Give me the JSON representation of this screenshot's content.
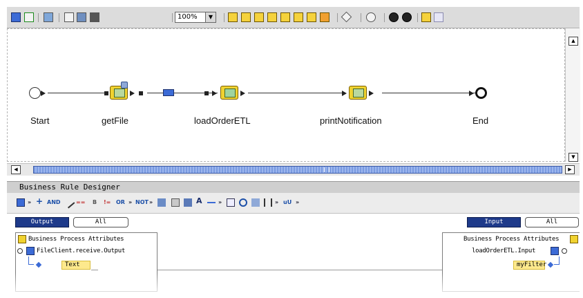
{
  "toolbar": {
    "zoom_value": "100%"
  },
  "canvas": {
    "nodes": [
      {
        "label": "Start"
      },
      {
        "label": "getFile"
      },
      {
        "label": "loadOrderETL"
      },
      {
        "label": "printNotification"
      },
      {
        "label": "End"
      }
    ]
  },
  "designer": {
    "title": "Business Rule Designer",
    "toolbar": {
      "and_label": "AND",
      "or_label": "OR",
      "not_label": "NOT"
    },
    "left_pane": {
      "tab_output": "Output",
      "tab_all": "All",
      "root_label": "Business Process Attributes",
      "node_label": "FileClient.receive.Output",
      "field_label": "Text"
    },
    "right_pane": {
      "tab_input": "Input",
      "tab_all": "All",
      "root_label": "Business Process Attributes",
      "node_label": "loadOrderETL.Input",
      "field_label": "myFilter"
    }
  },
  "colors": {
    "active_tab": "#1e3a8a",
    "scroll_thumb": "#7a9be0",
    "activity_icon": "#f0d230",
    "field_chip": "#fde98d"
  }
}
